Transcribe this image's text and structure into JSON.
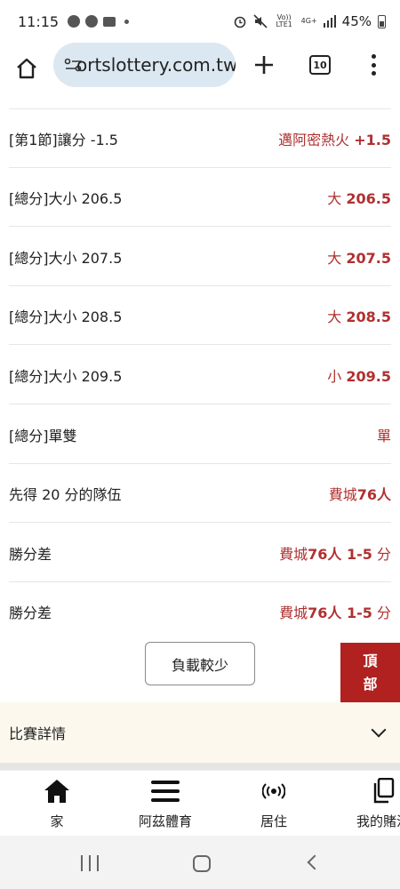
{
  "status_bar": {
    "time": "11:15",
    "battery": "45%",
    "network_volte": "Vo)) LTE1",
    "network_4g": "4G+"
  },
  "browser": {
    "url": "ortslottery.com.tw",
    "tab_count": "10"
  },
  "bets": [
    {
      "market": "[第1節]讓分 -1.5",
      "pick_text": "邁阿密熱火",
      "pick_value": "+1.5"
    },
    {
      "market": "[總分]大小 206.5",
      "pick_text": "大",
      "pick_value": "206.5"
    },
    {
      "market": "[總分]大小 207.5",
      "pick_text": "大",
      "pick_value": "207.5"
    },
    {
      "market": "[總分]大小 208.5",
      "pick_text": "大",
      "pick_value": "208.5"
    },
    {
      "market": "[總分]大小 209.5",
      "pick_text": "小",
      "pick_value": "209.5"
    },
    {
      "market": "[總分]單雙",
      "pick_text": "單",
      "pick_value": ""
    },
    {
      "market": "先得 20 分的隊伍",
      "pick_text": "費城",
      "pick_value": "76人"
    },
    {
      "market": "勝分差",
      "pick_text": "費城",
      "pick_value": "76人 1-5",
      "pick_suffix": "分"
    },
    {
      "market": "勝分差",
      "pick_text": "費城",
      "pick_value": "76人 1-5",
      "pick_suffix": "分"
    }
  ],
  "load_less_label": "負載較少",
  "top_button": {
    "line1": "頂",
    "line2": "部"
  },
  "details": {
    "title": "比賽詳情"
  },
  "bottom_nav": [
    {
      "label": "家",
      "icon": "home-icon"
    },
    {
      "label": "阿茲體育",
      "icon": "hamburger-menu-icon"
    },
    {
      "label": "居住",
      "icon": "live-broadcast-icon"
    },
    {
      "label": "我的賭注",
      "icon": "my-bets-icon"
    }
  ],
  "colors": {
    "accent_red": "#b0211f",
    "odds_red": "#b03030",
    "url_pill": "#dce8f1",
    "details_bg": "#fcf8ee"
  }
}
